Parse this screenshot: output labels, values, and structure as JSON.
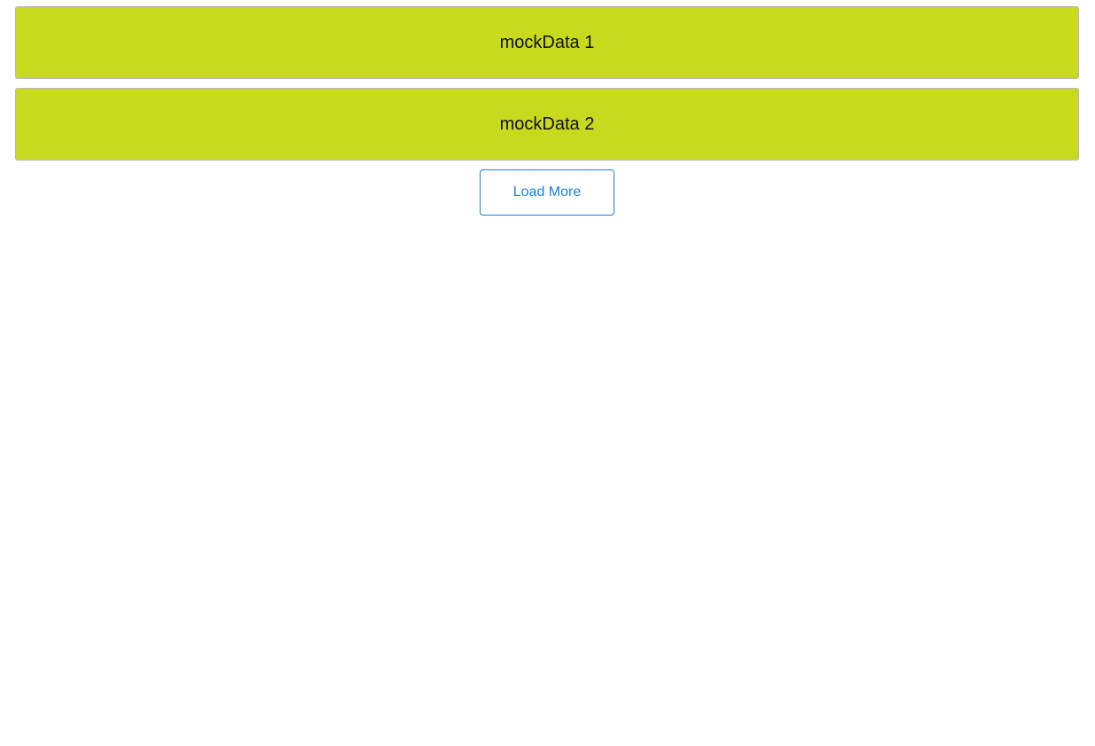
{
  "list": {
    "items": [
      {
        "label": "mockData 1"
      },
      {
        "label": "mockData 2"
      }
    ]
  },
  "load_more": {
    "label": "Load More"
  },
  "colors": {
    "item_background": "#c8da1e",
    "item_border": "#b8b8b8",
    "button_accent": "#1a7fe6"
  }
}
